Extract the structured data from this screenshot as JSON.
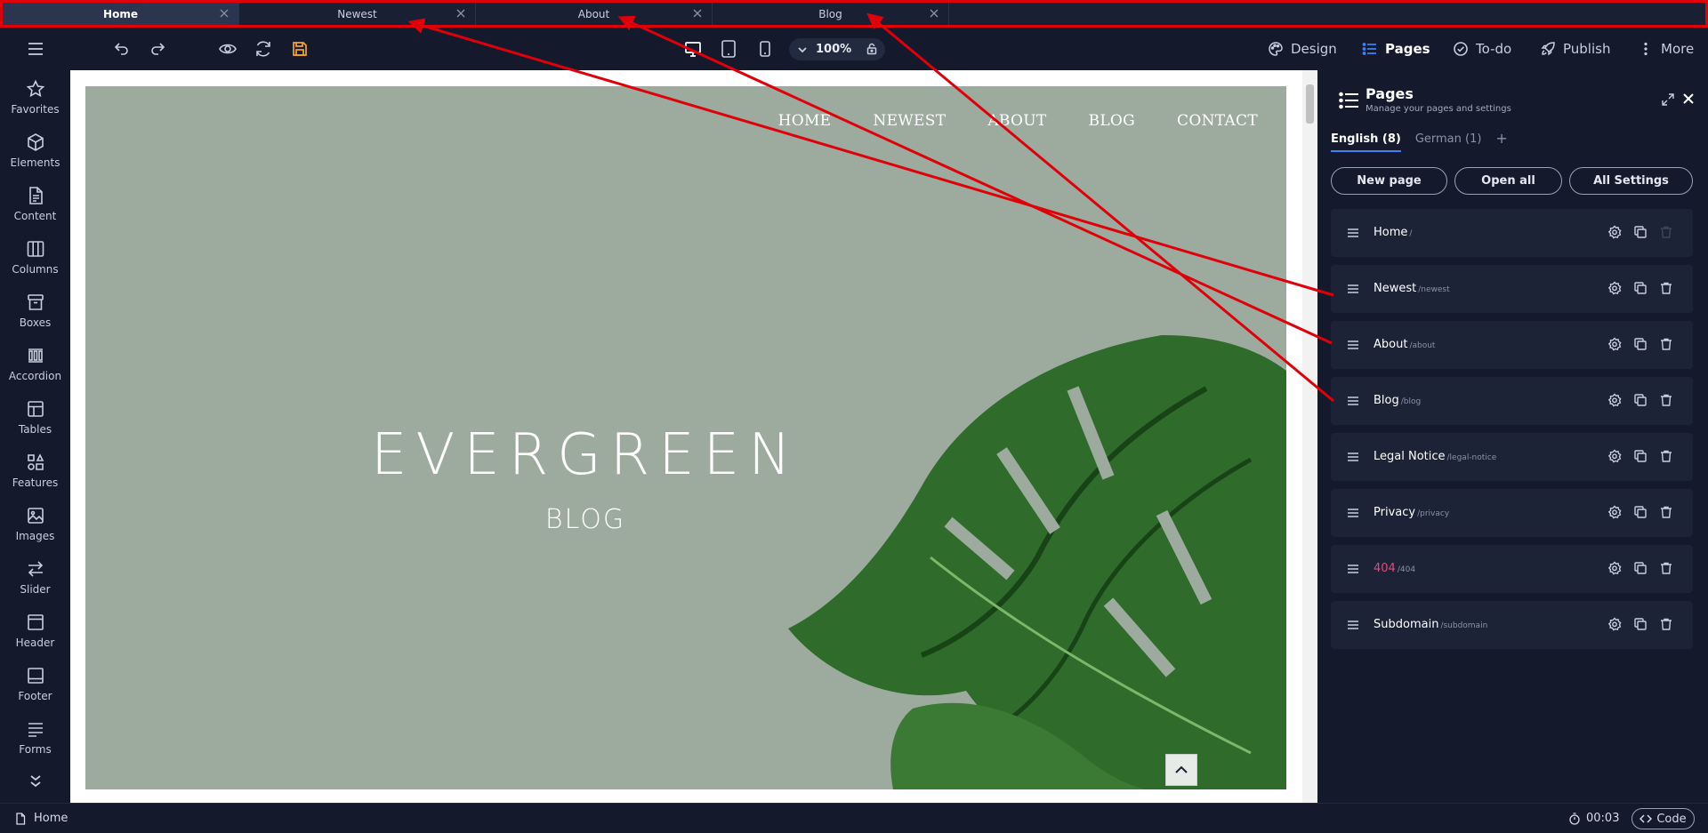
{
  "tabs": [
    {
      "label": "Home",
      "active": true
    },
    {
      "label": "Newest",
      "active": false
    },
    {
      "label": "About",
      "active": false
    },
    {
      "label": "Blog",
      "active": false
    }
  ],
  "toolbar": {
    "zoom": "100%",
    "menu": [
      {
        "label": "Design",
        "icon": "palette-icon"
      },
      {
        "label": "Pages",
        "icon": "list-icon",
        "active": true
      },
      {
        "label": "To-do",
        "icon": "check-circle-icon"
      },
      {
        "label": "Publish",
        "icon": "rocket-icon"
      },
      {
        "label": "More",
        "icon": "more-vertical-icon"
      }
    ]
  },
  "sidebar": {
    "items": [
      {
        "label": "Favorites",
        "icon": "star-icon"
      },
      {
        "label": "Elements",
        "icon": "cube-icon"
      },
      {
        "label": "Content",
        "icon": "document-icon"
      },
      {
        "label": "Columns",
        "icon": "columns-icon"
      },
      {
        "label": "Boxes",
        "icon": "box-icon"
      },
      {
        "label": "Accordion",
        "icon": "accordion-icon"
      },
      {
        "label": "Tables",
        "icon": "table-icon"
      },
      {
        "label": "Features",
        "icon": "features-icon"
      },
      {
        "label": "Images",
        "icon": "image-icon"
      },
      {
        "label": "Slider",
        "icon": "slider-icon"
      },
      {
        "label": "Header",
        "icon": "header-icon"
      },
      {
        "label": "Footer",
        "icon": "footer-icon"
      },
      {
        "label": "Forms",
        "icon": "forms-icon"
      }
    ]
  },
  "preview": {
    "nav": [
      "HOME",
      "NEWEST",
      "ABOUT",
      "BLOG",
      "CONTACT"
    ],
    "title": "EVERGREEN",
    "subtitle": "BLOG"
  },
  "panel": {
    "title": "Pages",
    "subtitle": "Manage your pages and settings",
    "languages": [
      {
        "label": "English (8)",
        "active": true
      },
      {
        "label": "German (1)",
        "active": false
      }
    ],
    "add_language": "+",
    "buttons": {
      "new_page": "New page",
      "open_all": "Open all",
      "all_settings": "All Settings"
    },
    "pages": [
      {
        "name": "Home",
        "slug": "/"
      },
      {
        "name": "Newest",
        "slug": "/newest"
      },
      {
        "name": "About",
        "slug": "/about"
      },
      {
        "name": "Blog",
        "slug": "/blog"
      },
      {
        "name": "Legal Notice",
        "slug": "/legal-notice"
      },
      {
        "name": "Privacy",
        "slug": "/privacy"
      },
      {
        "name": "404",
        "slug": "/404"
      },
      {
        "name": "Subdomain",
        "slug": "/subdomain"
      }
    ]
  },
  "statusbar": {
    "page": "Home",
    "time": "00:03",
    "code": "Code"
  },
  "colors": {
    "accent": "#3b82f6",
    "annotation": "#e0000a",
    "save": "#f5a623",
    "error_page": "#e04a7c",
    "hero_bg": "#9dab9e"
  }
}
